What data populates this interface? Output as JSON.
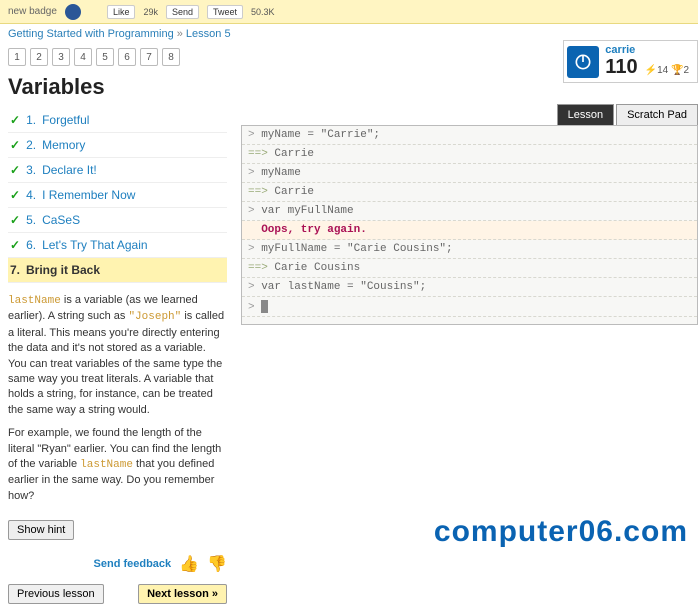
{
  "topbar": {
    "badge_text": "new badge",
    "like_label": "Like",
    "like_count": "29k",
    "send_label": "Send",
    "tweet_label": "Tweet",
    "tweet_count": "50.3K"
  },
  "breadcrumb": {
    "course": "Getting Started with Programming",
    "sep": " » ",
    "lesson": "Lesson 5"
  },
  "pager": [
    "1",
    "2",
    "3",
    "4",
    "5",
    "6",
    "7",
    "8"
  ],
  "title": "Variables",
  "stages": [
    {
      "num": "1.",
      "label": "Forgetful",
      "done": true
    },
    {
      "num": "2.",
      "label": "Memory",
      "done": true
    },
    {
      "num": "3.",
      "label": "Declare It!",
      "done": true
    },
    {
      "num": "4.",
      "label": "I Remember Now",
      "done": true
    },
    {
      "num": "5.",
      "label": "CaSeS",
      "done": true
    },
    {
      "num": "6.",
      "label": "Let's Try That Again",
      "done": true
    },
    {
      "num": "7.",
      "label": "Bring it Back",
      "done": false,
      "current": true
    }
  ],
  "prose": {
    "p1a": "lastName",
    "p1b": " is a variable (as we learned earlier). A string such as ",
    "p1c": "\"Joseph\"",
    "p1d": " is called a literal. This means you're directly entering the data and it's not stored as a variable. You can treat variables of the same type the same way you treat literals. A variable that holds a string, for instance, can be treated the same way a string would.",
    "p2a": "For example, we found the length of the literal \"Ryan\" earlier. You can find the length of the variable ",
    "p2b": "lastName",
    "p2c": " that you defined earlier in the same way. Do you remember how?"
  },
  "buttons": {
    "hint": "Show hint",
    "feedback": "Send feedback",
    "prev": "Previous lesson",
    "next": "Next lesson »"
  },
  "user": {
    "name": "carrie",
    "score": "110",
    "bolt": "14",
    "trophy": "2"
  },
  "tabs": {
    "lesson": "Lesson",
    "scratch": "Scratch Pad"
  },
  "console": [
    {
      "t": "in",
      "text": "myName = \"Carrie\";"
    },
    {
      "t": "out",
      "text": "Carrie"
    },
    {
      "t": "in",
      "text": "myName"
    },
    {
      "t": "out",
      "text": "Carrie"
    },
    {
      "t": "in",
      "text": "var myFullName"
    },
    {
      "t": "err",
      "text": "Oops, try again."
    },
    {
      "t": "in",
      "text": "myFullName = \"Carie Cousins\";"
    },
    {
      "t": "out",
      "text": "Carie Cousins"
    },
    {
      "t": "in",
      "text": "var lastName = \"Cousins\";"
    },
    {
      "t": "cursor",
      "text": ""
    }
  ],
  "watermark": "computer06.com"
}
